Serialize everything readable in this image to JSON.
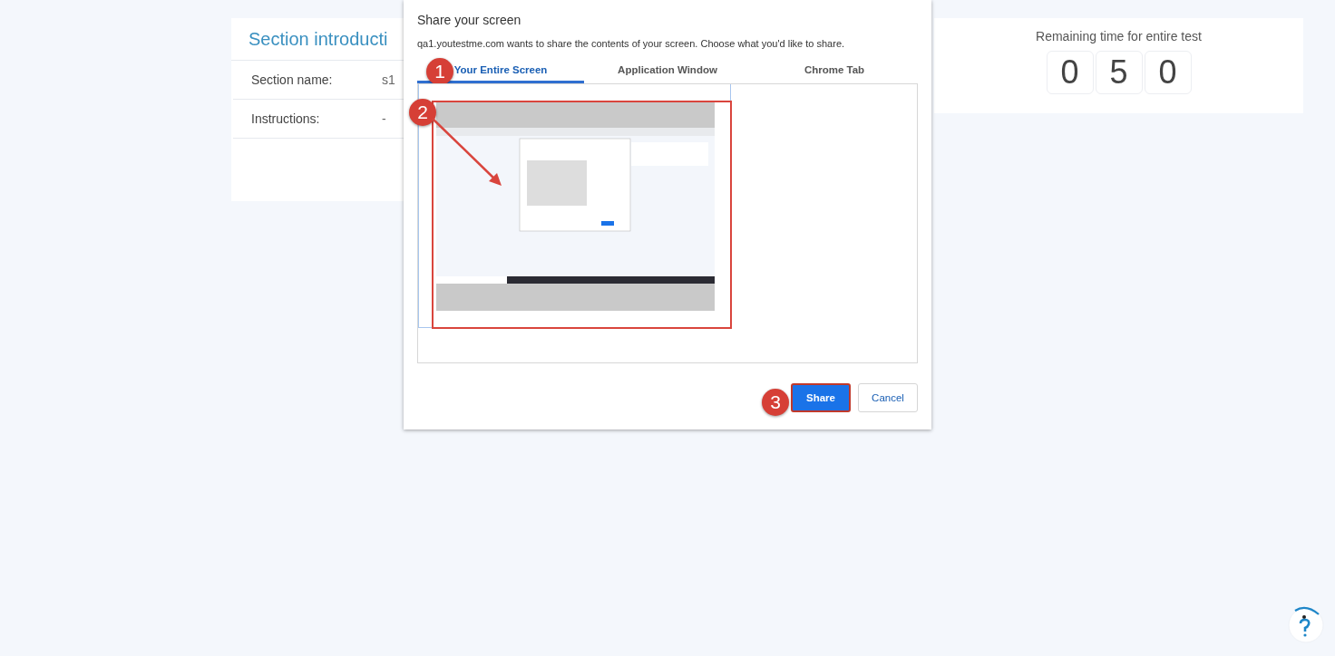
{
  "section_card": {
    "title": "Section introducti",
    "rows": [
      {
        "label": "Section name:",
        "value": "s1"
      },
      {
        "label": "Instructions:",
        "value": "-"
      }
    ]
  },
  "dialog": {
    "title": "Share your screen",
    "message": "qa1.youtestme.com wants to share the contents of your screen. Choose what you'd like to share.",
    "tabs": [
      {
        "label": "Your Entire Screen",
        "selected": true,
        "step": "1"
      },
      {
        "label": "Application Window",
        "selected": false
      },
      {
        "label": "Chrome Tab",
        "selected": false
      }
    ],
    "screens": [
      {
        "kind": "screen",
        "selected": true,
        "step": "2"
      }
    ],
    "buttons": [
      {
        "label": "Share",
        "kind": "primary",
        "highlighted": true,
        "step": "3"
      },
      {
        "label": "Cancel",
        "kind": "secondary",
        "highlighted": false
      }
    ]
  },
  "timer": {
    "title": "Remaining time for entire test",
    "digits": [
      "0",
      "5",
      "0"
    ]
  }
}
